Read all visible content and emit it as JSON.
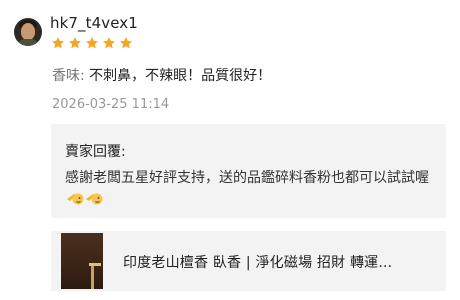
{
  "user": {
    "name": "hk7_t4vex1",
    "rating": 5,
    "rating_max": 5
  },
  "review": {
    "label": "香味:",
    "text": " 不刺鼻，不辣眼！品質很好！",
    "date": "2026-03-25 11:14"
  },
  "reply": {
    "title": "賣家回覆:",
    "text": "感謝老闆五星好評支持，送的品鑑碎料香粉也都可以試試喔"
  },
  "product": {
    "name": "印度老山檀香 臥香 | 淨化磁場 招財 轉運..."
  },
  "colors": {
    "star": "#f6a623",
    "reply_bg": "#f3f3f3",
    "muted_text": "#999999"
  }
}
